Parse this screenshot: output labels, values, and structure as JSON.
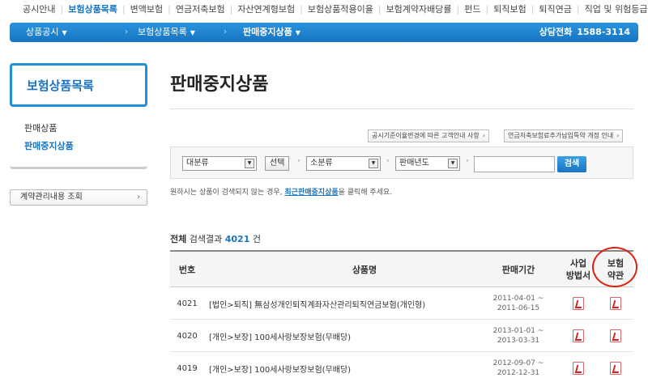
{
  "topnav": {
    "items": [
      "공시안내",
      "보험상품목록",
      "변액보험",
      "연금저축보험",
      "자산연계형보험",
      "보험상품적용이율",
      "보험계약자배당률",
      "펀드",
      "퇴직보험",
      "퇴직연금",
      "직업 및 위험등급 안내"
    ],
    "active_index": 1
  },
  "bluebar": {
    "crumb1": "상품공시",
    "crumb2": "보험상품목록",
    "crumb3": "판매중지상품",
    "phone_label": "상담전화",
    "phone_number": "1588-3114"
  },
  "sidebar": {
    "title": "보험상품목록",
    "menu": [
      "판매상품",
      "판매중지상품"
    ],
    "contract_button": "계약관리내용 조회"
  },
  "main": {
    "title": "판매중지상품",
    "notice1": "공시기준이율변경에 따른 고객안내 사항",
    "notice2": "연금저축보험료추가납입특약 개정 안내",
    "search": {
      "category1": "대분류",
      "select_btn": "선택",
      "category2": "소분류",
      "year": "판매년도",
      "submit": "검색"
    },
    "hint_pre": "원하시는 상품이 검색되지 않는 경우,",
    "hint_link": "최근판매중지상품",
    "hint_post": "을 클릭해 주세요.",
    "total_label": "전체",
    "total_mid": "검색결과",
    "total_count": "4021",
    "total_unit": "건"
  },
  "table": {
    "headers": {
      "num": "번호",
      "name": "상품명",
      "period": "판매기간",
      "method_1": "사업",
      "method_2": "방법서",
      "terms_1": "보험",
      "terms_2": "약관"
    },
    "rows": [
      {
        "num": "4021",
        "name": "[법인>퇴직] 無삼성개인퇴직계좌자산관리퇴직연금보험(개인형)",
        "from": "2011-04-01 ~",
        "to": "2011-06-15"
      },
      {
        "num": "4020",
        "name": "[개인>보장] 100세사랑보장보험(무배당)",
        "from": "2013-01-01 ~",
        "to": "2013-03-31"
      },
      {
        "num": "4019",
        "name": "[개인>보장] 100세사랑보장보험(무배당)",
        "from": "2012-09-07 ~",
        "to": "2012-12-31"
      }
    ]
  },
  "colors": {
    "accent": "#1a74c1",
    "highlight_circle": "#d21111"
  }
}
